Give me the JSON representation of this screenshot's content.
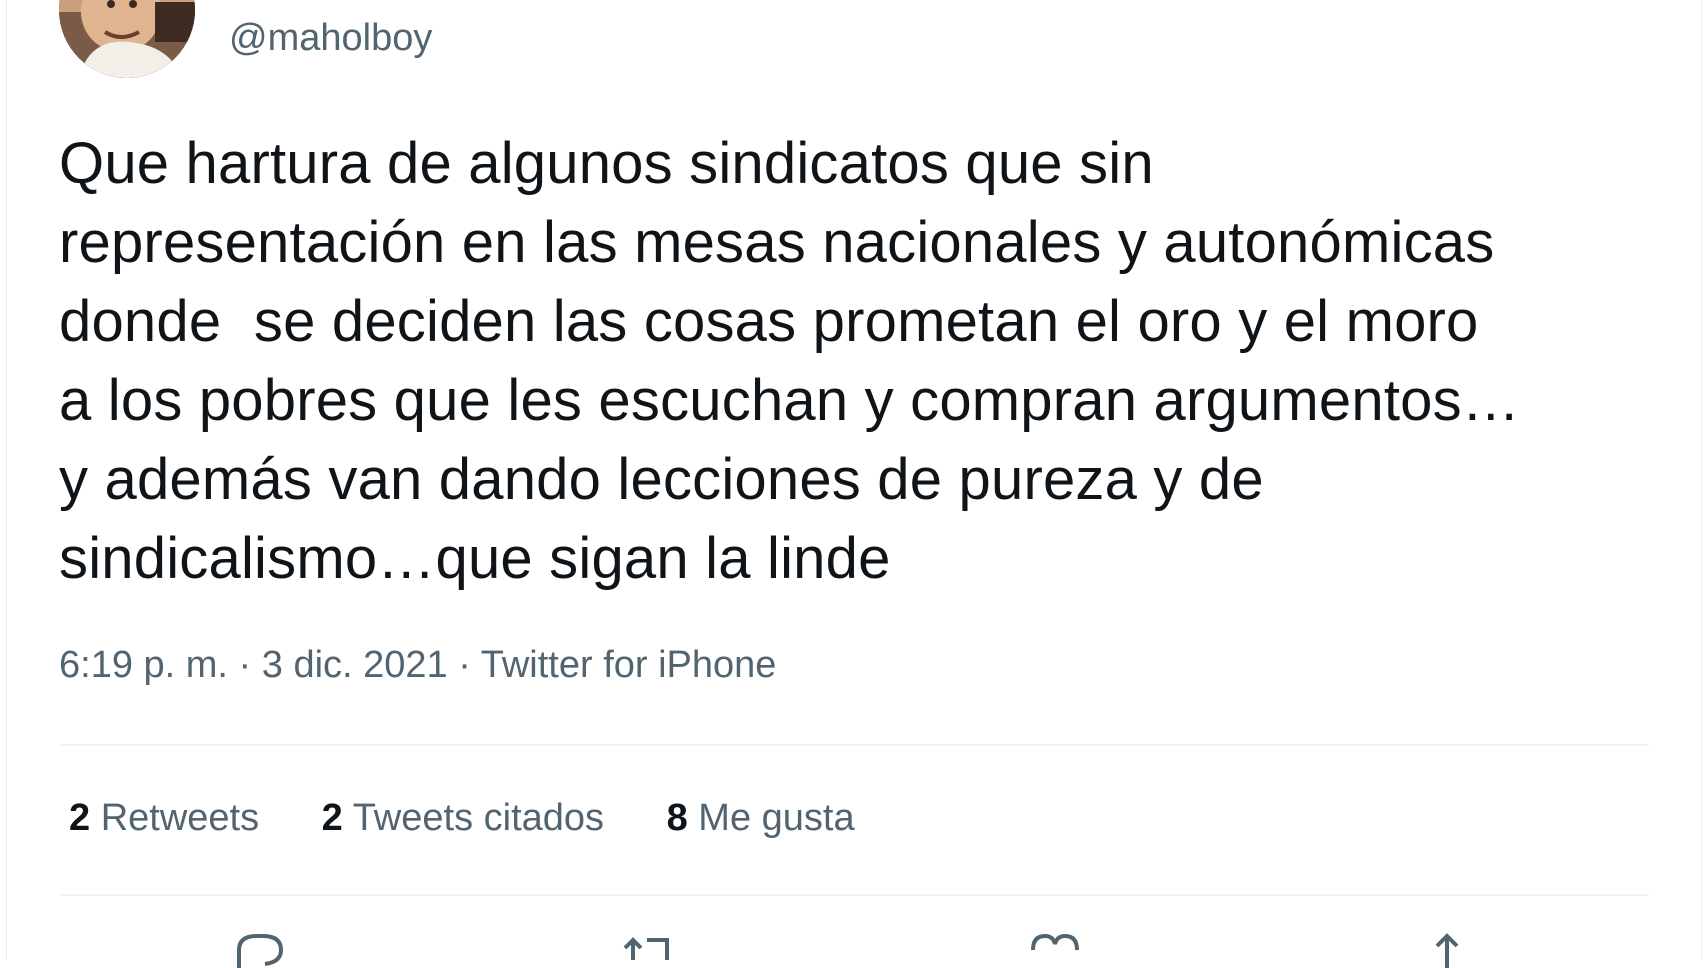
{
  "author": {
    "handle": "@maholboy",
    "avatar_icon": "profile-photo"
  },
  "tweet": {
    "lines": [
      "Que hartura de algunos sindicatos que sin",
      "representación en las mesas nacionales y autonómicas",
      "donde  se deciden las cosas prometan el oro y el moro",
      "a los pobres que les escuchan y compran argumentos…",
      "y además van dando lecciones de pureza y de",
      "sindicalismo…que sigan la linde"
    ],
    "meta": "6:19 p. m. · 3 dic. 2021 · Twitter for iPhone"
  },
  "stats": {
    "retweets": {
      "count": "2",
      "label": "Retweets"
    },
    "quotes": {
      "count": "2",
      "label": "Tweets citados"
    },
    "likes": {
      "count": "8",
      "label": "Me gusta"
    }
  },
  "actions": [
    {
      "name": "reply-icon"
    },
    {
      "name": "retweet-icon"
    },
    {
      "name": "like-icon"
    },
    {
      "name": "share-icon"
    }
  ],
  "colors": {
    "text_primary": "#0f1419",
    "text_secondary": "#536471",
    "divider": "#eff3f4"
  }
}
